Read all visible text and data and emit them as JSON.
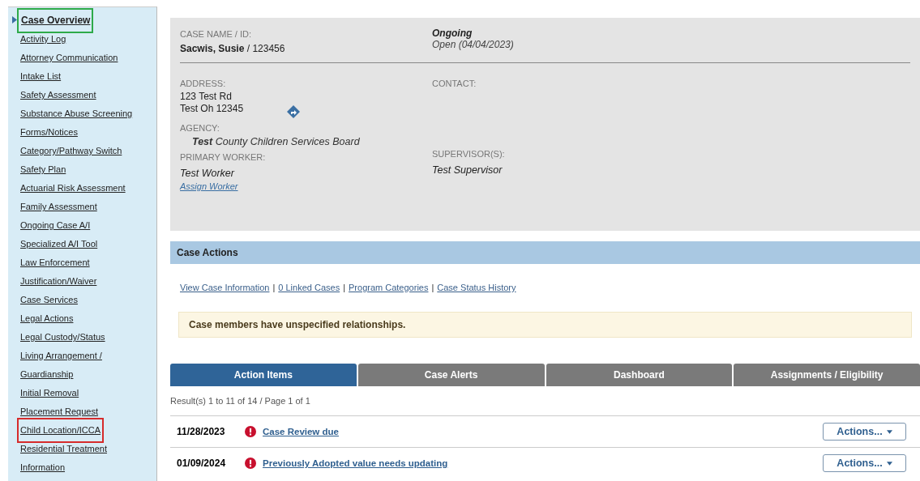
{
  "sidebar": {
    "items": [
      {
        "label": "Case Overview",
        "selected": true,
        "color": "#2eaa4a"
      },
      {
        "label": "Activity Log",
        "selected": false
      },
      {
        "label": "Attorney Communication",
        "selected": false
      },
      {
        "label": "Intake List",
        "selected": false
      },
      {
        "label": "Safety Assessment",
        "selected": false
      },
      {
        "label": "Substance Abuse Screening",
        "selected": false
      },
      {
        "label": "Forms/Notices",
        "selected": false
      },
      {
        "label": "Category/Pathway Switch",
        "selected": false
      },
      {
        "label": "Safety Plan",
        "selected": false
      },
      {
        "label": "Actuarial Risk Assessment",
        "selected": false
      },
      {
        "label": "Family Assessment",
        "selected": false
      },
      {
        "label": "Ongoing Case A/I",
        "selected": false
      },
      {
        "label": "Specialized A/I Tool",
        "selected": false
      },
      {
        "label": "Law Enforcement",
        "selected": false
      },
      {
        "label": "Justification/Waiver",
        "selected": false
      },
      {
        "label": "Case Services",
        "selected": false
      },
      {
        "label": "Legal Actions",
        "selected": false
      },
      {
        "label": "Legal Custody/Status",
        "selected": false
      },
      {
        "label": "Living Arrangement / Guardianship",
        "selected": false
      },
      {
        "label": "Initial Removal",
        "selected": false
      },
      {
        "label": "Placement Request",
        "selected": false
      },
      {
        "label": "Child Location/ICCA",
        "selected": false,
        "color": "#d62b2b"
      },
      {
        "label": "Residential Treatment Information",
        "selected": false
      }
    ]
  },
  "case_header": {
    "case_name_label": "CASE NAME / ID:",
    "case_name": "Sacwis, Susie",
    "case_id": " / 123456",
    "status": "Ongoing",
    "status_detail": "Open (04/04/2023)",
    "address_label": "ADDRESS:",
    "address_lines": [
      "123 Test Rd",
      "Test Oh 12345"
    ],
    "contact_label": "CONTACT:",
    "agency_label": "AGENCY:",
    "agency_prefix": "Test",
    "agency_name": "County Children Services Board",
    "primary_worker_label": "PRIMARY WORKER:",
    "primary_worker": "Test Worker",
    "assign_link": "Assign Worker",
    "supervisor_label": "SUPERVISOR(S):",
    "supervisor": "Test Supervisor"
  },
  "case_actions": {
    "title": "Case Actions",
    "links": [
      "View Case Information",
      "0 Linked Cases",
      "Program Categories",
      "Case Status History"
    ],
    "separator": "|",
    "alert": "Case members have unspecified relationships."
  },
  "tabs": [
    {
      "label": "Action Items",
      "selected": true
    },
    {
      "label": "Case Alerts",
      "selected": false
    },
    {
      "label": "Dashboard",
      "selected": false
    },
    {
      "label": "Assignments / Eligibility",
      "selected": false
    }
  ],
  "results": "Result(s) 1 to 11 of 14 / Page 1 of 1",
  "action_items": [
    {
      "date": "11/28/2023",
      "title": "Case Review due",
      "button": "Actions..."
    },
    {
      "date": "01/09/2024",
      "title": "Previously Adopted value needs updating",
      "button": "Actions..."
    }
  ]
}
